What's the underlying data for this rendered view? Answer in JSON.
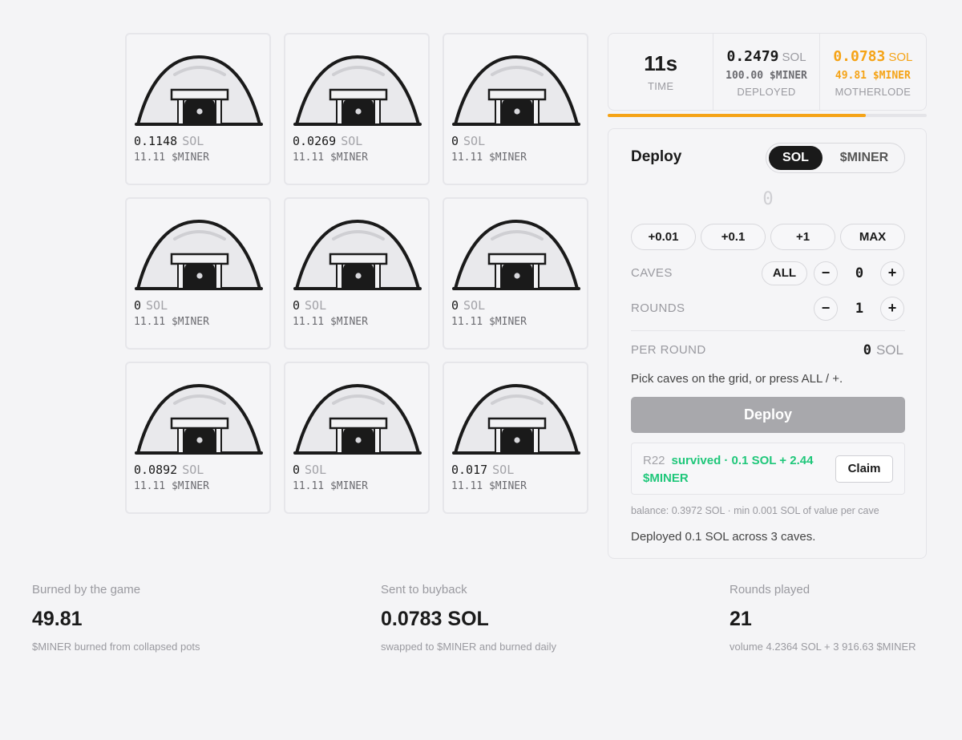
{
  "caves": [
    {
      "sol": "0.1148",
      "unit": "SOL",
      "miner": "11.11 $MINER"
    },
    {
      "sol": "0.0269",
      "unit": "SOL",
      "miner": "11.11 $MINER"
    },
    {
      "sol": "0",
      "unit": "SOL",
      "miner": "11.11 $MINER"
    },
    {
      "sol": "0",
      "unit": "SOL",
      "miner": "11.11 $MINER"
    },
    {
      "sol": "0",
      "unit": "SOL",
      "miner": "11.11 $MINER"
    },
    {
      "sol": "0",
      "unit": "SOL",
      "miner": "11.11 $MINER"
    },
    {
      "sol": "0.0892",
      "unit": "SOL",
      "miner": "11.11 $MINER"
    },
    {
      "sol": "0",
      "unit": "SOL",
      "miner": "11.11 $MINER"
    },
    {
      "sol": "0.017",
      "unit": "SOL",
      "miner": "11.11 $MINER"
    }
  ],
  "cave_icon": "cave-icon",
  "stats": {
    "time": {
      "value": "11s",
      "label": "TIME"
    },
    "deployed": {
      "value": "0.2479",
      "unit": "SOL",
      "sub": "100.00 $MINER",
      "label": "DEPLOYED"
    },
    "motherlode": {
      "value": "0.0783",
      "unit": "SOL",
      "sub": "49.81 $MINER",
      "label": "MOTHERLODE"
    }
  },
  "round_progress": 0.81,
  "colors": {
    "accent": "#f5a316",
    "success": "#1fc77a",
    "dark": "#1a1a1a"
  },
  "deploy": {
    "title": "Deploy",
    "currency_sol": "SOL",
    "currency_miner": "$MINER",
    "amount_placeholder": "0",
    "quick": [
      "+0.01",
      "+0.1",
      "+1",
      "MAX"
    ],
    "caves_label": "CAVES",
    "caves_all": "ALL",
    "caves_value": "0",
    "rounds_label": "ROUNDS",
    "rounds_value": "1",
    "minus": "−",
    "plus": "+",
    "per_round_label": "PER ROUND",
    "per_round_value": "0",
    "per_round_unit": "SOL",
    "hint": "Pick caves on the grid, or press ALL / +.",
    "button": "Deploy",
    "result_round": "R22",
    "result_text": "survived · 0.1 SOL + 2.44 $MINER",
    "claim": "Claim",
    "balance": "balance: 0.3972 SOL · min 0.001 SOL of value per cave",
    "deployed_note": "Deployed 0.1 SOL across 3 caves."
  },
  "bottom": [
    {
      "label": "Burned by the game",
      "value": "49.81",
      "sub": "$MINER burned from collapsed pots"
    },
    {
      "label": "Sent to buyback",
      "value": "0.0783 SOL",
      "sub": "swapped to $MINER and burned daily"
    },
    {
      "label": "Rounds played",
      "value": "21",
      "sub": "volume 4.2364 SOL + 3 916.63 $MINER"
    }
  ]
}
